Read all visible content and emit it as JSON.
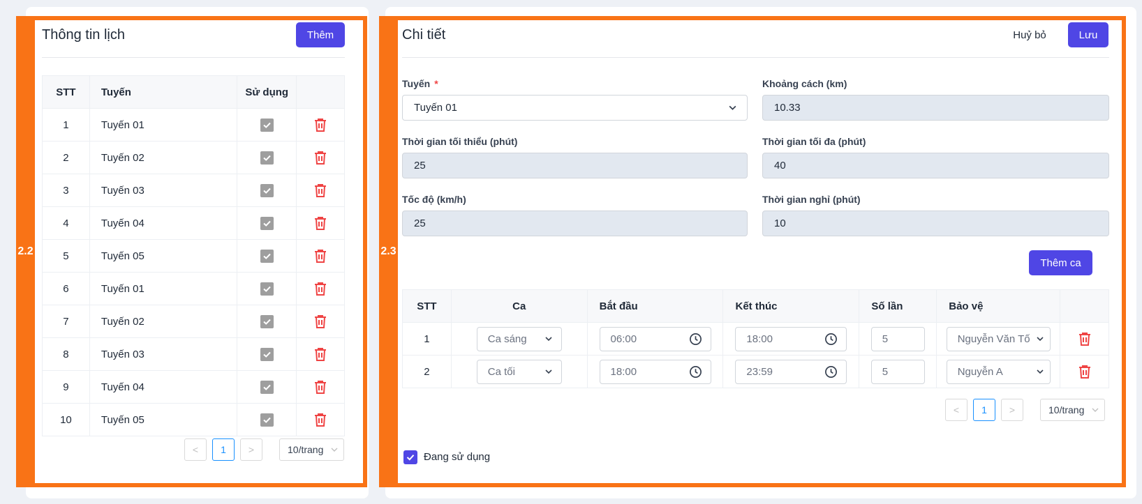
{
  "left": {
    "badge": "2.2",
    "title": "Thông tin lịch",
    "add_button": "Thêm",
    "columns": [
      "STT",
      "Tuyến",
      "Sử dụng"
    ],
    "rows": [
      {
        "stt": "1",
        "route": "Tuyến 01",
        "used": true
      },
      {
        "stt": "2",
        "route": "Tuyến 02",
        "used": true
      },
      {
        "stt": "3",
        "route": "Tuyến 03",
        "used": true
      },
      {
        "stt": "4",
        "route": "Tuyến 04",
        "used": true
      },
      {
        "stt": "5",
        "route": "Tuyến 05",
        "used": true
      },
      {
        "stt": "6",
        "route": "Tuyến 01",
        "used": true
      },
      {
        "stt": "7",
        "route": "Tuyến 02",
        "used": true
      },
      {
        "stt": "8",
        "route": "Tuyến 03",
        "used": true
      },
      {
        "stt": "9",
        "route": "Tuyến 04",
        "used": true
      },
      {
        "stt": "10",
        "route": "Tuyến 05",
        "used": true
      }
    ],
    "pagination": {
      "prev": "<",
      "current": "1",
      "next": ">",
      "page_size": "10/trang"
    }
  },
  "right": {
    "badge": "2.3",
    "title": "Chi tiết",
    "cancel_button": "Huỷ bỏ",
    "save_button": "Lưu",
    "form": {
      "route_label": "Tuyến",
      "route_required": "*",
      "route_value": "Tuyến 01",
      "distance_label": "Khoảng cách (km)",
      "distance_value": "10.33",
      "min_time_label": "Thời gian tối thiểu (phút)",
      "min_time_value": "25",
      "max_time_label": "Thời gian tối đa (phút)",
      "max_time_value": "40",
      "speed_label": "Tốc độ (km/h)",
      "speed_value": "25",
      "rest_label": "Thời gian nghỉ (phút)",
      "rest_value": "10"
    },
    "add_shift_button": "Thêm ca",
    "shift_columns": [
      "STT",
      "Ca",
      "Bắt đầu",
      "Kết thúc",
      "Số lần",
      "Bảo vệ"
    ],
    "shifts": [
      {
        "stt": "1",
        "shift": "Ca sáng",
        "start": "06:00",
        "end": "18:00",
        "count": "5",
        "guard": "Nguyễn Văn Tố"
      },
      {
        "stt": "2",
        "shift": "Ca tối",
        "start": "18:00",
        "end": "23:59",
        "count": "5",
        "guard": "Nguyễn A"
      }
    ],
    "pagination": {
      "prev": "<",
      "current": "1",
      "next": ">",
      "page_size": "10/trang"
    },
    "active_label": "Đang sử dụng",
    "active_checked": true
  },
  "colors": {
    "accent": "#4f46e5",
    "highlight": "#f97316",
    "danger": "#ef4444"
  },
  "icons": [
    "trash-icon",
    "checkbox-icon",
    "chevron-down-icon",
    "clock-icon"
  ]
}
